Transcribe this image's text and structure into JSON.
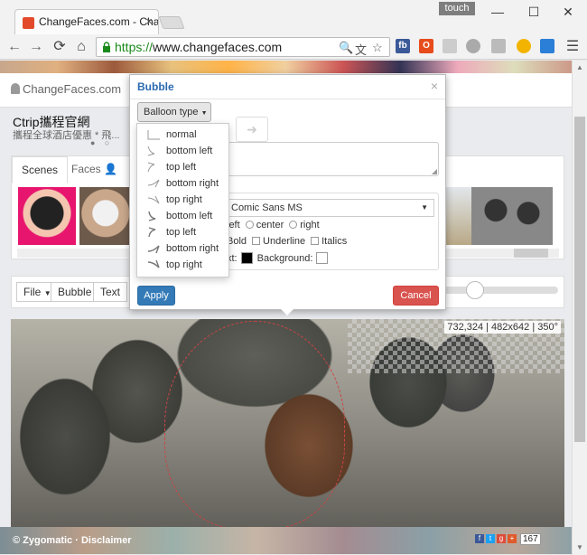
{
  "browser": {
    "tab_title": "ChangeFaces.com - Cha",
    "tab_close": "×",
    "touch_label": "touch",
    "window_buttons": [
      "—",
      "☐",
      "✕"
    ],
    "url_scheme": "https://",
    "url_host": "www.changefaces.com",
    "nav": {
      "back": "←",
      "forward": "→",
      "reload": "⟳",
      "home": "⌂"
    },
    "ext_icons": [
      "fb",
      "O"
    ]
  },
  "site": {
    "logo": "ChangeFaces.com",
    "ad_title": "Ctrip攜程官網",
    "ad_subtitle": "攜程全球酒店優惠 * 飛...",
    "dots": "● ○",
    "tabs": [
      "Scenes",
      "Faces"
    ],
    "toolbar": [
      "File",
      "Bubble",
      "Text"
    ],
    "coords": "732,324 | 482x642 | 350°",
    "footer": "© Zygomatic · Disclaimer",
    "share_count": "167"
  },
  "modal": {
    "title": "Bubble",
    "close": "×",
    "balloon_type": "Balloon type",
    "arrow_glyph": "➜",
    "font": "Comic Sans MS",
    "align": [
      "left",
      "center",
      "right"
    ],
    "styles": [
      "Bold",
      "Underline",
      "Italics"
    ],
    "text_label": "xt:",
    "background_label": "Background:",
    "apply": "Apply",
    "cancel": "Cancel",
    "text_color": "#000000",
    "background_color": "#ffffff"
  },
  "balloon_types": [
    "normal",
    "bottom left",
    "top left",
    "bottom right",
    "top right",
    "bottom left",
    "top left",
    "bottom right",
    "top right"
  ],
  "colors": {
    "primary": "#337ab7",
    "danger": "#d9534f",
    "url_green": "#1a8a1a"
  }
}
